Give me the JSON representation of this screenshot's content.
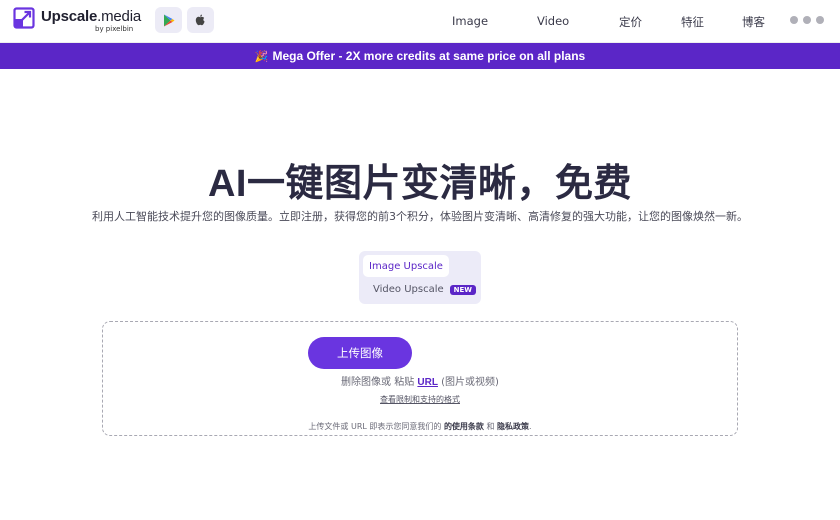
{
  "header": {
    "logo_text": "Upscale.media",
    "logo_byline": "by pixelbin",
    "store_buttons": [
      {
        "icon": "google-play-icon"
      },
      {
        "icon": "apple-icon"
      }
    ],
    "nav": [
      {
        "label": "Image"
      },
      {
        "label": "Video"
      },
      {
        "label": "定价"
      },
      {
        "label": "特征"
      },
      {
        "label": "博客"
      }
    ],
    "more_icon": "more-dots-icon"
  },
  "banner": {
    "emoji": "🎉",
    "text": "Mega Offer - 2X more credits at same price on all plans"
  },
  "hero": {
    "title": "AI一键图片变清晰，免费",
    "subtitle": "利用人工智能技术提升您的图像质量。立即注册，获得您的前3个积分，体验图片变清晰、高清修复的强大功能，让您的图像焕然一新。"
  },
  "tabs": {
    "image": "Image Upscale",
    "video": "Video Upscale",
    "new_badge": "NEW"
  },
  "upload": {
    "button_label": "上传图像",
    "drop_prefix": "删除图像或 粘贴",
    "url_label": "URL",
    "drop_suffix": "(图片或视频)",
    "limits_link": "查看限制和支持的格式",
    "terms_prefix": "上传文件或 URL 即表示您同意我们的",
    "terms_link": "的使用条款",
    "terms_and": "和",
    "privacy_link": "隐私政策",
    "terms_end": "."
  },
  "colors": {
    "brand": "#5b26c7",
    "button": "#6a35e0",
    "tab_bg": "#ecebf8"
  }
}
